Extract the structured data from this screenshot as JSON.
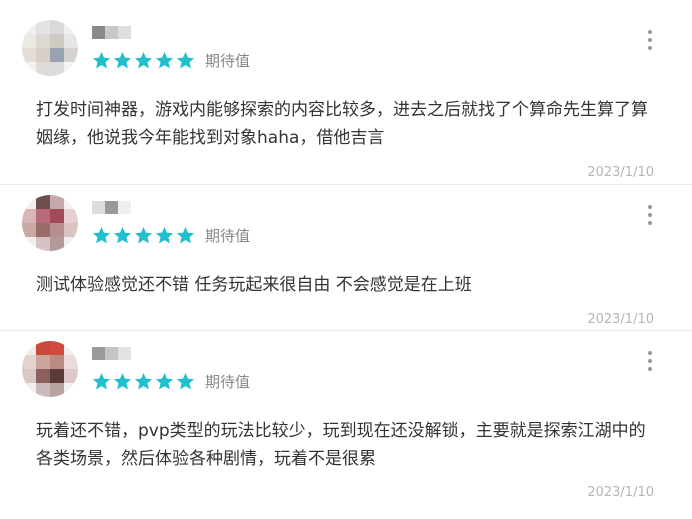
{
  "colors": {
    "star": "#22bfcc",
    "divider": "#ececec",
    "date": "#b5b5b5",
    "meta": "#888888",
    "text": "#333333"
  },
  "icons": {
    "rating": "star-icon",
    "menu": "more-vertical-icon"
  },
  "reviews": [
    {
      "rating": 5,
      "rating_label": "期待值",
      "content": "打发时间神器，游戏内能够探索的内容比较多，进去之后就找了个算命先生算了算姻缘，他说我今年能找到对象haha，借他吉言",
      "date": "2023/1/10"
    },
    {
      "rating": 5,
      "rating_label": "期待值",
      "content": "测试体验感觉还不错 任务玩起来很自由 不会感觉是在上班",
      "date": "2023/1/10"
    },
    {
      "rating": 5,
      "rating_label": "期待值",
      "content": "玩着还不错，pvp类型的玩法比较少，玩到现在还没解锁，主要就是探索江湖中的各类场景，然后体验各种剧情，玩着不是很累",
      "date": "2023/1/10"
    }
  ]
}
